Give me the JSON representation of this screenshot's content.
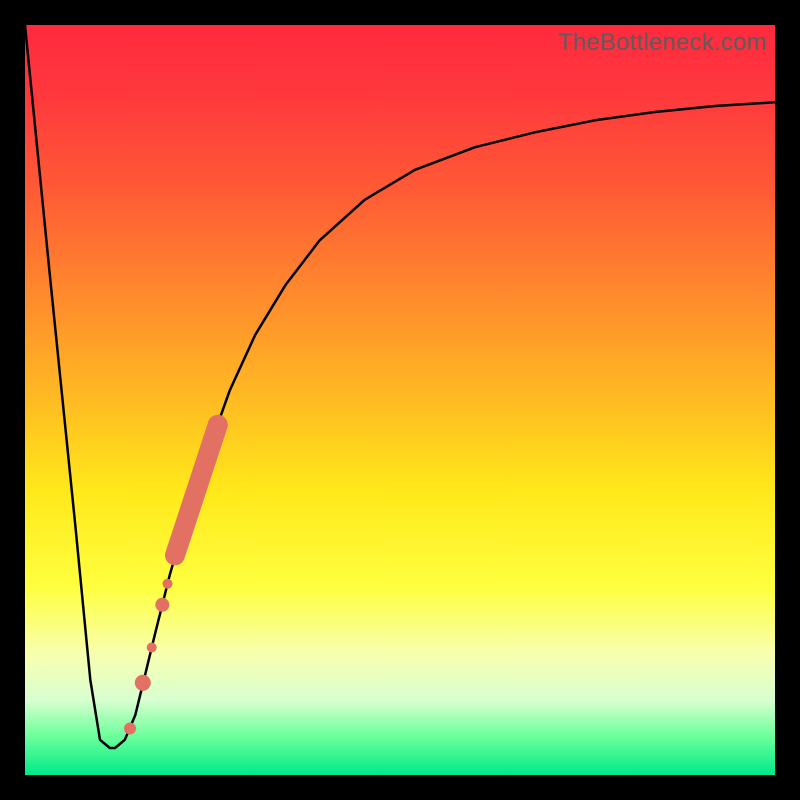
{
  "watermark": "TheBottleneck.com",
  "chart_data": {
    "type": "line",
    "title": "",
    "xlabel": "",
    "ylabel": "",
    "xlim": [
      0,
      100
    ],
    "ylim": [
      0,
      100
    ],
    "grid": false,
    "series": [
      {
        "name": "curve",
        "x": [
          0,
          3.3,
          6.7,
          8.7,
          10.0,
          11.3,
          12.0,
          13.3,
          14.7,
          16.0,
          17.3,
          19.3,
          22.0,
          24.7,
          27.3,
          30.7,
          34.7,
          39.3,
          45.3,
          52.0,
          60.0,
          68.0,
          76.0,
          84.0,
          92.0,
          100.0
        ],
        "y": [
          100,
          66.7,
          33.3,
          12.7,
          4.7,
          3.6,
          3.6,
          4.7,
          8.0,
          13.3,
          18.7,
          26.7,
          36.0,
          44.0,
          51.3,
          58.7,
          65.3,
          71.3,
          76.7,
          80.7,
          83.7,
          85.7,
          87.3,
          88.4,
          89.2,
          89.7
        ],
        "stroke": "#000000",
        "stroke_width": 2.5
      }
    ],
    "markers": [
      {
        "name": "marker-1",
        "x": 14.0,
        "y": 6.2,
        "r": 6,
        "fill": "#e27164"
      },
      {
        "name": "marker-2",
        "x": 15.7,
        "y": 12.3,
        "r": 8,
        "fill": "#e27164"
      },
      {
        "name": "marker-3",
        "x": 16.9,
        "y": 17.0,
        "r": 5,
        "fill": "#e27164"
      },
      {
        "name": "marker-4",
        "x": 18.3,
        "y": 22.7,
        "r": 7,
        "fill": "#e27164"
      },
      {
        "name": "marker-5",
        "x": 19.0,
        "y": 25.5,
        "r": 5,
        "fill": "#e27164"
      },
      {
        "name": "thick-segment",
        "x0": 20.0,
        "y0": 29.3,
        "x1": 25.7,
        "y1": 46.7,
        "stroke": "#e27164",
        "stroke_width": 20
      }
    ]
  }
}
